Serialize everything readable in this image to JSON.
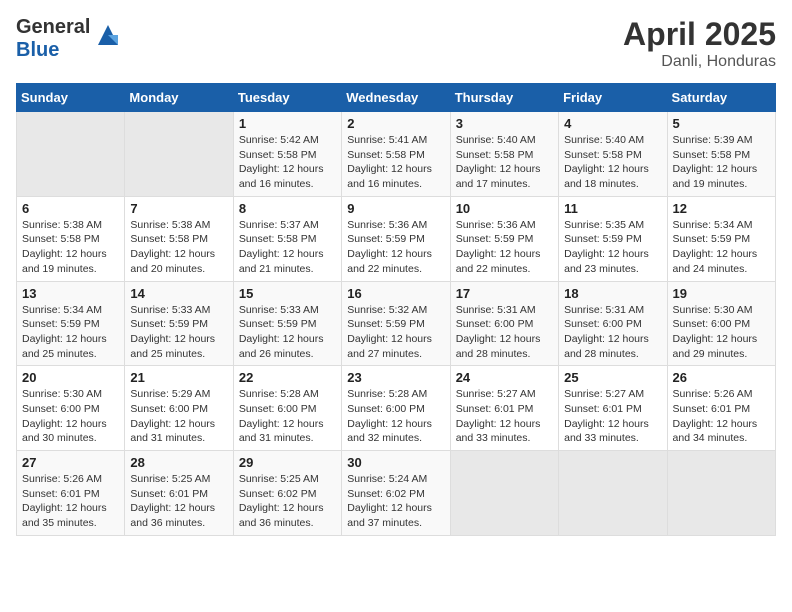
{
  "header": {
    "logo_general": "General",
    "logo_blue": "Blue",
    "title": "April 2025",
    "subtitle": "Danli, Honduras"
  },
  "days_of_week": [
    "Sunday",
    "Monday",
    "Tuesday",
    "Wednesday",
    "Thursday",
    "Friday",
    "Saturday"
  ],
  "weeks": [
    [
      {
        "day": "",
        "sunrise": "",
        "sunset": "",
        "daylight": ""
      },
      {
        "day": "",
        "sunrise": "",
        "sunset": "",
        "daylight": ""
      },
      {
        "day": "1",
        "sunrise": "Sunrise: 5:42 AM",
        "sunset": "Sunset: 5:58 PM",
        "daylight": "Daylight: 12 hours and 16 minutes."
      },
      {
        "day": "2",
        "sunrise": "Sunrise: 5:41 AM",
        "sunset": "Sunset: 5:58 PM",
        "daylight": "Daylight: 12 hours and 16 minutes."
      },
      {
        "day": "3",
        "sunrise": "Sunrise: 5:40 AM",
        "sunset": "Sunset: 5:58 PM",
        "daylight": "Daylight: 12 hours and 17 minutes."
      },
      {
        "day": "4",
        "sunrise": "Sunrise: 5:40 AM",
        "sunset": "Sunset: 5:58 PM",
        "daylight": "Daylight: 12 hours and 18 minutes."
      },
      {
        "day": "5",
        "sunrise": "Sunrise: 5:39 AM",
        "sunset": "Sunset: 5:58 PM",
        "daylight": "Daylight: 12 hours and 19 minutes."
      }
    ],
    [
      {
        "day": "6",
        "sunrise": "Sunrise: 5:38 AM",
        "sunset": "Sunset: 5:58 PM",
        "daylight": "Daylight: 12 hours and 19 minutes."
      },
      {
        "day": "7",
        "sunrise": "Sunrise: 5:38 AM",
        "sunset": "Sunset: 5:58 PM",
        "daylight": "Daylight: 12 hours and 20 minutes."
      },
      {
        "day": "8",
        "sunrise": "Sunrise: 5:37 AM",
        "sunset": "Sunset: 5:58 PM",
        "daylight": "Daylight: 12 hours and 21 minutes."
      },
      {
        "day": "9",
        "sunrise": "Sunrise: 5:36 AM",
        "sunset": "Sunset: 5:59 PM",
        "daylight": "Daylight: 12 hours and 22 minutes."
      },
      {
        "day": "10",
        "sunrise": "Sunrise: 5:36 AM",
        "sunset": "Sunset: 5:59 PM",
        "daylight": "Daylight: 12 hours and 22 minutes."
      },
      {
        "day": "11",
        "sunrise": "Sunrise: 5:35 AM",
        "sunset": "Sunset: 5:59 PM",
        "daylight": "Daylight: 12 hours and 23 minutes."
      },
      {
        "day": "12",
        "sunrise": "Sunrise: 5:34 AM",
        "sunset": "Sunset: 5:59 PM",
        "daylight": "Daylight: 12 hours and 24 minutes."
      }
    ],
    [
      {
        "day": "13",
        "sunrise": "Sunrise: 5:34 AM",
        "sunset": "Sunset: 5:59 PM",
        "daylight": "Daylight: 12 hours and 25 minutes."
      },
      {
        "day": "14",
        "sunrise": "Sunrise: 5:33 AM",
        "sunset": "Sunset: 5:59 PM",
        "daylight": "Daylight: 12 hours and 25 minutes."
      },
      {
        "day": "15",
        "sunrise": "Sunrise: 5:33 AM",
        "sunset": "Sunset: 5:59 PM",
        "daylight": "Daylight: 12 hours and 26 minutes."
      },
      {
        "day": "16",
        "sunrise": "Sunrise: 5:32 AM",
        "sunset": "Sunset: 5:59 PM",
        "daylight": "Daylight: 12 hours and 27 minutes."
      },
      {
        "day": "17",
        "sunrise": "Sunrise: 5:31 AM",
        "sunset": "Sunset: 6:00 PM",
        "daylight": "Daylight: 12 hours and 28 minutes."
      },
      {
        "day": "18",
        "sunrise": "Sunrise: 5:31 AM",
        "sunset": "Sunset: 6:00 PM",
        "daylight": "Daylight: 12 hours and 28 minutes."
      },
      {
        "day": "19",
        "sunrise": "Sunrise: 5:30 AM",
        "sunset": "Sunset: 6:00 PM",
        "daylight": "Daylight: 12 hours and 29 minutes."
      }
    ],
    [
      {
        "day": "20",
        "sunrise": "Sunrise: 5:30 AM",
        "sunset": "Sunset: 6:00 PM",
        "daylight": "Daylight: 12 hours and 30 minutes."
      },
      {
        "day": "21",
        "sunrise": "Sunrise: 5:29 AM",
        "sunset": "Sunset: 6:00 PM",
        "daylight": "Daylight: 12 hours and 31 minutes."
      },
      {
        "day": "22",
        "sunrise": "Sunrise: 5:28 AM",
        "sunset": "Sunset: 6:00 PM",
        "daylight": "Daylight: 12 hours and 31 minutes."
      },
      {
        "day": "23",
        "sunrise": "Sunrise: 5:28 AM",
        "sunset": "Sunset: 6:00 PM",
        "daylight": "Daylight: 12 hours and 32 minutes."
      },
      {
        "day": "24",
        "sunrise": "Sunrise: 5:27 AM",
        "sunset": "Sunset: 6:01 PM",
        "daylight": "Daylight: 12 hours and 33 minutes."
      },
      {
        "day": "25",
        "sunrise": "Sunrise: 5:27 AM",
        "sunset": "Sunset: 6:01 PM",
        "daylight": "Daylight: 12 hours and 33 minutes."
      },
      {
        "day": "26",
        "sunrise": "Sunrise: 5:26 AM",
        "sunset": "Sunset: 6:01 PM",
        "daylight": "Daylight: 12 hours and 34 minutes."
      }
    ],
    [
      {
        "day": "27",
        "sunrise": "Sunrise: 5:26 AM",
        "sunset": "Sunset: 6:01 PM",
        "daylight": "Daylight: 12 hours and 35 minutes."
      },
      {
        "day": "28",
        "sunrise": "Sunrise: 5:25 AM",
        "sunset": "Sunset: 6:01 PM",
        "daylight": "Daylight: 12 hours and 36 minutes."
      },
      {
        "day": "29",
        "sunrise": "Sunrise: 5:25 AM",
        "sunset": "Sunset: 6:02 PM",
        "daylight": "Daylight: 12 hours and 36 minutes."
      },
      {
        "day": "30",
        "sunrise": "Sunrise: 5:24 AM",
        "sunset": "Sunset: 6:02 PM",
        "daylight": "Daylight: 12 hours and 37 minutes."
      },
      {
        "day": "",
        "sunrise": "",
        "sunset": "",
        "daylight": ""
      },
      {
        "day": "",
        "sunrise": "",
        "sunset": "",
        "daylight": ""
      },
      {
        "day": "",
        "sunrise": "",
        "sunset": "",
        "daylight": ""
      }
    ]
  ]
}
